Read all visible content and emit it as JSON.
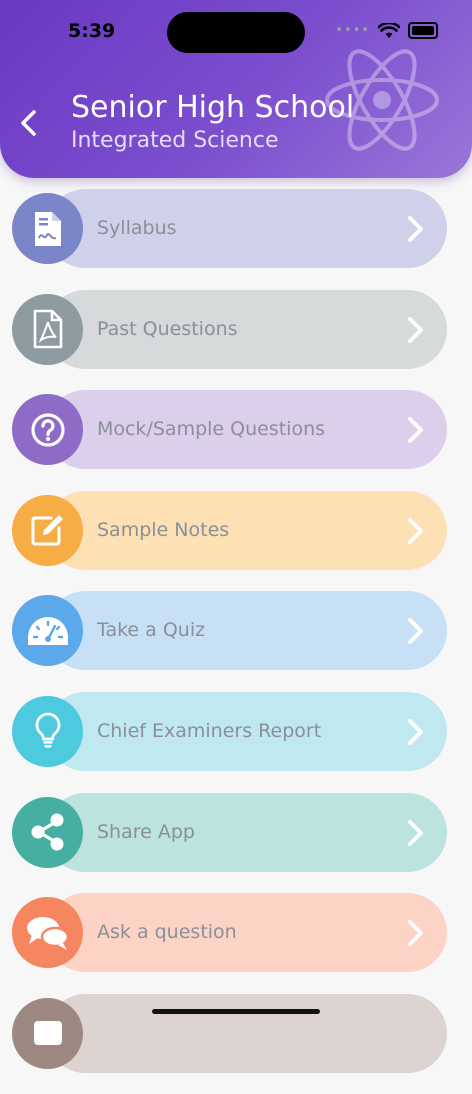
{
  "status": {
    "time": "5:39",
    "signal_dots": "••••"
  },
  "header": {
    "title": "Senior High School",
    "subtitle": "Integrated Science"
  },
  "menu": [
    {
      "label": "Syllabus",
      "icon": "document-signature-icon",
      "pill": "#cfd1ea",
      "circle": "#7b86c8"
    },
    {
      "label": "Past Questions",
      "icon": "pdf-file-icon",
      "pill": "#d6dadb",
      "circle": "#8e9ba0"
    },
    {
      "label": "Mock/Sample Questions",
      "icon": "question-circle-icon",
      "pill": "#dccfec",
      "circle": "#8f6bc8"
    },
    {
      "label": "Sample Notes",
      "icon": "edit-note-icon",
      "pill": "#fde0b4",
      "circle": "#f6ad45"
    },
    {
      "label": "Take a Quiz",
      "icon": "speedometer-icon",
      "pill": "#c7e0f6",
      "circle": "#5ba8ea"
    },
    {
      "label": "Chief Examiners Report",
      "icon": "lightbulb-icon",
      "pill": "#bfe8f0",
      "circle": "#4dcade"
    },
    {
      "label": "Share App",
      "icon": "share-icon",
      "pill": "#bde3de",
      "circle": "#45b0a2"
    },
    {
      "label": "Ask a question",
      "icon": "chat-bubbles-icon",
      "pill": "#fcd3c5",
      "circle": "#f58660"
    },
    {
      "label": "",
      "icon": "partial-item-icon",
      "pill": "#ddd3d1",
      "circle": "#9e8882"
    }
  ]
}
